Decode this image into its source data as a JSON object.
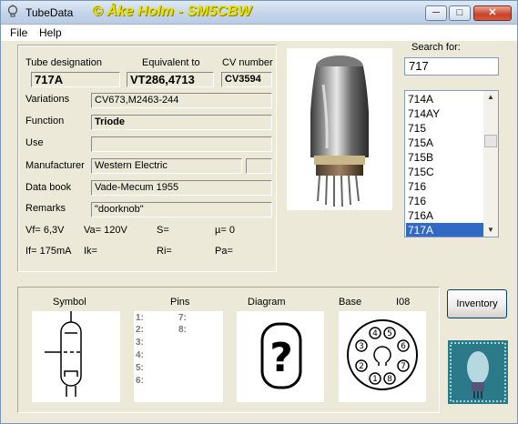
{
  "window": {
    "title": "TubeData",
    "credit": "© Åke Holm - SM5CBW",
    "min_label": "─",
    "max_label": "□",
    "close_label": "✕"
  },
  "menu": [
    {
      "label": "File"
    },
    {
      "label": "Help"
    }
  ],
  "tube": {
    "designation_label": "Tube designation",
    "designation": "717A",
    "equivalent_label": "Equivalent to",
    "equivalent": "VT286,4713",
    "cv_label": "CV number",
    "cv": "CV3594",
    "variations_label": "Variations",
    "variations": "CV673,M2463-244",
    "function_label": "Function",
    "function": "Triode",
    "use_label": "Use",
    "use": "",
    "manufacturer_label": "Manufacturer",
    "manufacturer": "Western Electric",
    "databook_label": "Data book",
    "databook": "Vade-Mecum 1955",
    "remarks_label": "Remarks",
    "remarks": "\"doorknob\""
  },
  "params": {
    "vf": "Vf= 6,3V",
    "va": "Va= 120V",
    "s": "S=",
    "mu": "µ=    0",
    "if": "If= 175mA",
    "ik": "Ik=",
    "ri": "Ri=",
    "pa": "Pa="
  },
  "search": {
    "label": "Search for:",
    "value": "717"
  },
  "list": {
    "items": [
      "714A",
      "714AY",
      "715",
      "715A",
      "715B",
      "715C",
      "716",
      "716",
      "716A",
      "717A"
    ],
    "selected_index": 9
  },
  "bottom": {
    "symbol_label": "Symbol",
    "pins_label": "Pins",
    "diagram_label": "Diagram",
    "base_label": "Base",
    "base_type": "I08",
    "pins_left": [
      "1:",
      "2:",
      "3:",
      "4:",
      "5:",
      "6:"
    ],
    "pins_right": [
      "7:",
      "8:"
    ],
    "base_pins": [
      "1",
      "2",
      "3",
      "4",
      "5",
      "6",
      "7",
      "8"
    ]
  },
  "inventory_button": "Inventory",
  "colors": {
    "selection": "#316ac5",
    "title_credit": "#e8e000"
  }
}
